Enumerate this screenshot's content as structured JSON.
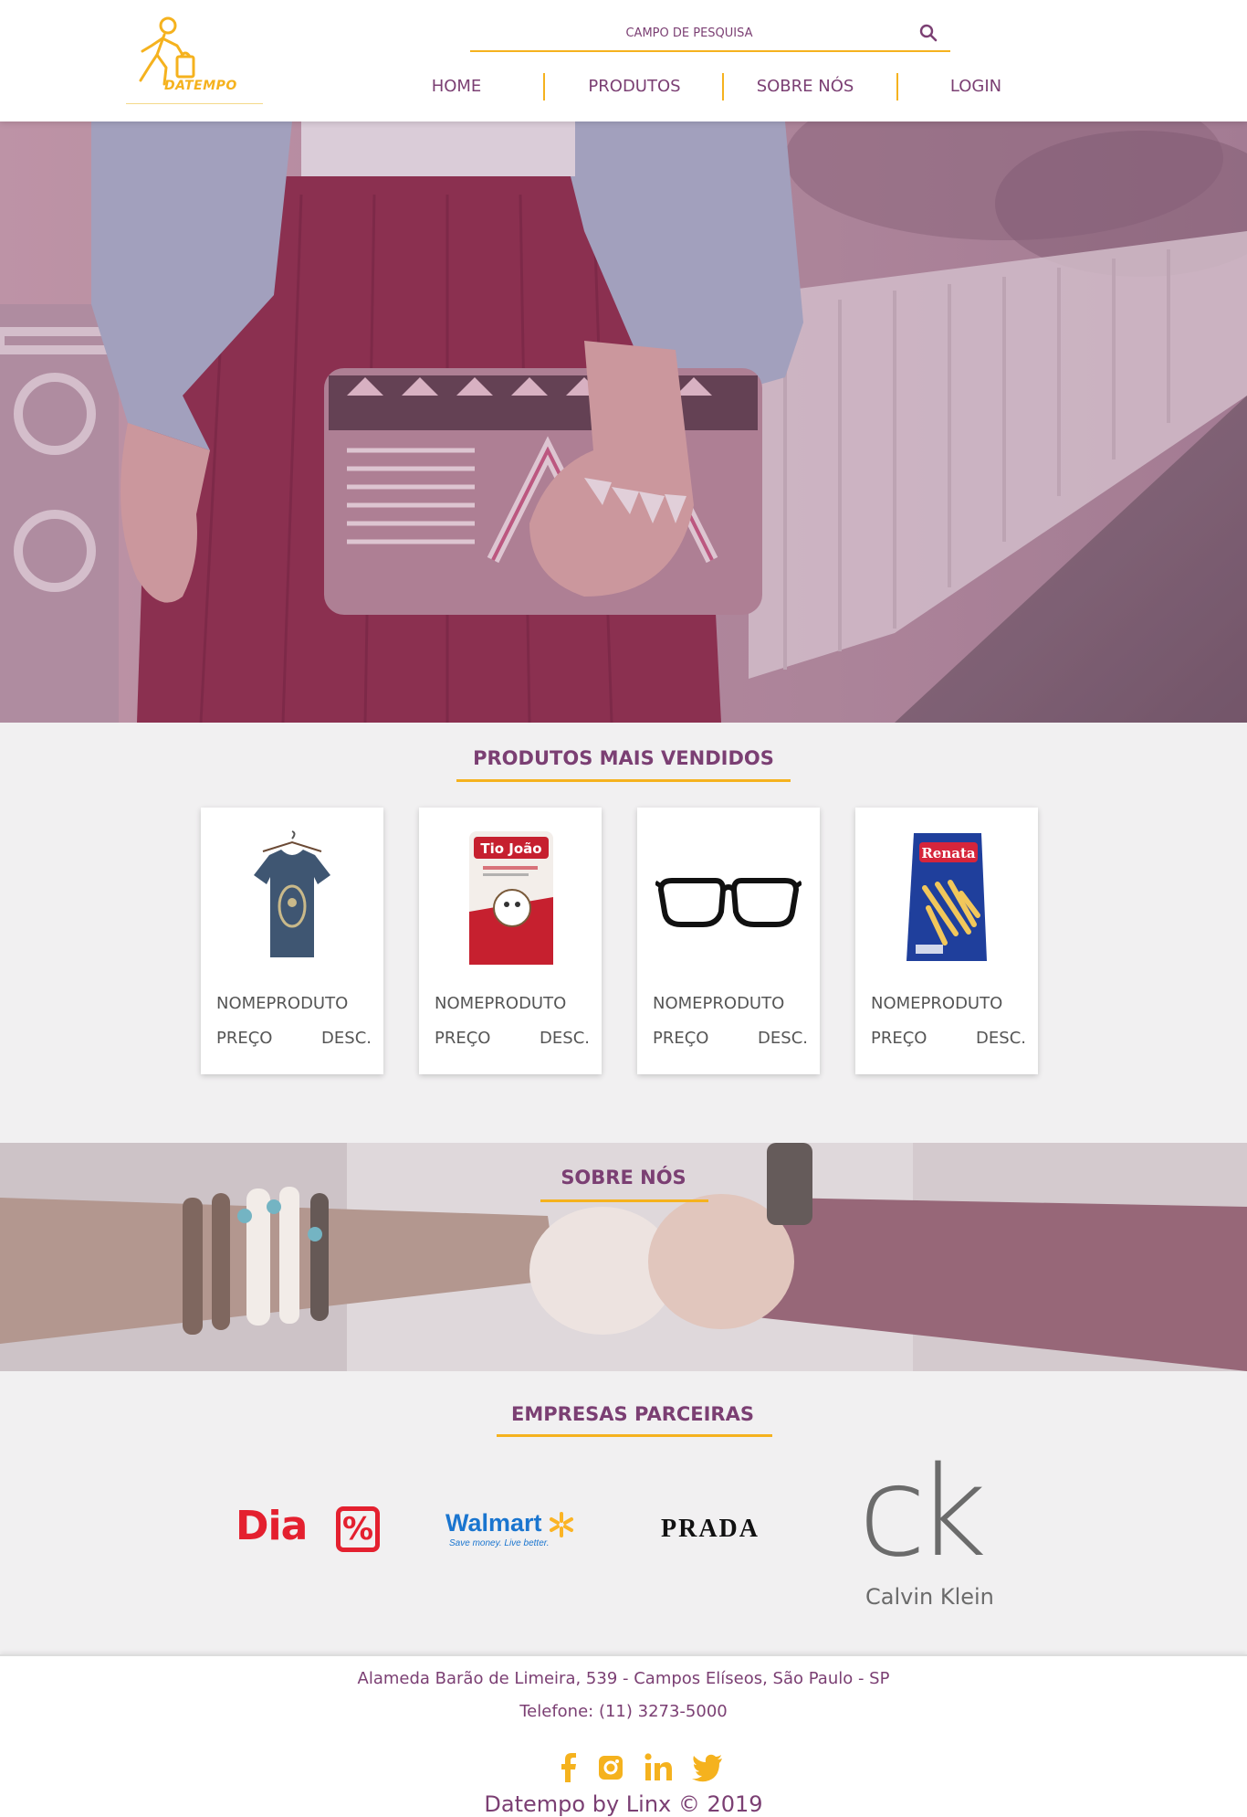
{
  "brand": {
    "logo_text": "DATEMPO",
    "primary_color": "#7b3f73",
    "accent_color": "#f5b21e"
  },
  "search": {
    "placeholder": "CAMPO DE PESQUISA",
    "value": "",
    "icon": "search-icon"
  },
  "nav": {
    "items": [
      {
        "label": "HOME"
      },
      {
        "label": "PRODUTOS"
      },
      {
        "label": "SOBRE NÓS"
      },
      {
        "label": "LOGIN"
      }
    ]
  },
  "bestsellers": {
    "title": "PRODUTOS MAIS VENDIDOS",
    "products": [
      {
        "name": "NOMEPRODUTO",
        "price": "PREÇO",
        "desc": "DESC.",
        "icon": "tshirt-image"
      },
      {
        "name": "NOMEPRODUTO",
        "price": "PREÇO",
        "desc": "DESC.",
        "icon": "rice-package-image"
      },
      {
        "name": "NOMEPRODUTO",
        "price": "PREÇO",
        "desc": "DESC.",
        "icon": "glasses-image"
      },
      {
        "name": "NOMEPRODUTO",
        "price": "PREÇO",
        "desc": "DESC.",
        "icon": "pasta-package-image"
      }
    ]
  },
  "about": {
    "title": "SOBRE NÓS"
  },
  "partners": {
    "title": "EMPRESAS PARCEIRAS",
    "logos": [
      {
        "name": "Dia",
        "symbol": "%"
      },
      {
        "name": "Walmart",
        "tagline": "Save money. Live better."
      },
      {
        "name": "PRADA"
      },
      {
        "name": "Calvin Klein",
        "monogram": "ck"
      }
    ]
  },
  "footer": {
    "address": "Alameda Barão de Limeira, 539 - Campos Elíseos, São Paulo - SP",
    "phone": "Telefone: (11) 3273-5000",
    "copyright": "Datempo by Linx © 2019",
    "socials": [
      "facebook-icon",
      "instagram-icon",
      "linkedin-icon",
      "twitter-icon"
    ]
  }
}
